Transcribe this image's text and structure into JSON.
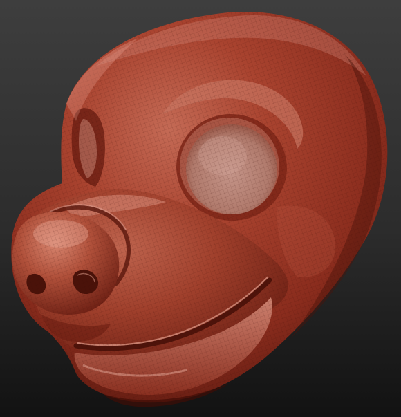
{
  "scene": {
    "subject": "sculpted-creature-head-render",
    "background_color_top": "#3c3c3c",
    "background_color_bottom": "#141414",
    "material_color": "#a33e2a",
    "material_highlight": "#cf7c68",
    "material_shadow": "#5a170f",
    "socket_color": "#b8877c",
    "wireframe": true
  }
}
